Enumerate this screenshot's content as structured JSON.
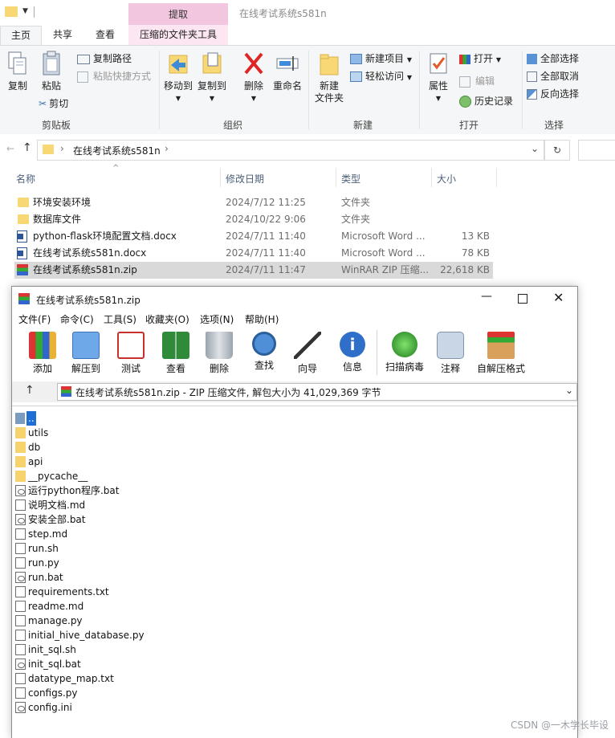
{
  "explorer": {
    "window_title": "在线考试系统s581n",
    "context_tab": "提取",
    "tabs": [
      "主页",
      "共享",
      "查看",
      "压缩的文件夹工具"
    ],
    "ribbon": {
      "copy": "复制",
      "paste": "粘贴",
      "copy_path": "复制路径",
      "paste_shortcut": "粘贴快捷方式",
      "cut": "剪切",
      "group_clipboard": "剪贴板",
      "move_to": "移动到",
      "copy_to": "复制到",
      "delete": "删除",
      "rename": "重命名",
      "group_organize": "组织",
      "new_folder_line1": "新建",
      "new_folder_line2": "文件夹",
      "new_item": "新建项目",
      "easy_access": "轻松访问",
      "group_new": "新建",
      "properties": "属性",
      "open": "打开",
      "edit": "编辑",
      "history": "历史记录",
      "group_open": "打开",
      "select_all": "全部选择",
      "select_none": "全部取消",
      "invert_selection": "反向选择",
      "group_select": "选择"
    },
    "address": {
      "path": "在线考试系统s581n"
    },
    "columns": {
      "name": "名称",
      "date": "修改日期",
      "type": "类型",
      "size": "大小"
    },
    "files": [
      {
        "name": "环境安装环境",
        "date": "2024/7/12 11:25",
        "type": "文件夹",
        "size": "",
        "icon": "folder-icon"
      },
      {
        "name": "数据库文件",
        "date": "2024/10/22 9:06",
        "type": "文件夹",
        "size": "",
        "icon": "folder-icon"
      },
      {
        "name": "python-flask环境配置文档.docx",
        "date": "2024/7/11 11:40",
        "type": "Microsoft Word ...",
        "size": "13 KB",
        "icon": "word-doc-icon"
      },
      {
        "name": "在线考试系统s581n.docx",
        "date": "2024/7/11 11:40",
        "type": "Microsoft Word ...",
        "size": "78 KB",
        "icon": "word-doc-icon"
      },
      {
        "name": "在线考试系统s581n.zip",
        "date": "2024/7/11 11:47",
        "type": "WinRAR ZIP 压缩...",
        "size": "22,618 KB",
        "icon": "winrar-zip-icon"
      }
    ]
  },
  "winrar": {
    "title": "在线考试系统s581n.zip",
    "menu": [
      "文件(F)",
      "命令(C)",
      "工具(S)",
      "收藏夹(O)",
      "选项(N)",
      "帮助(H)"
    ],
    "toolbar": [
      "添加",
      "解压到",
      "测试",
      "查看",
      "删除",
      "查找",
      "向导",
      "信息",
      "扫描病毒",
      "注释",
      "自解压格式"
    ],
    "path_text": "在线考试系统s581n.zip - ZIP 压缩文件, 解包大小为 41,029,369 字节",
    "entries": [
      {
        "name": "..",
        "kind": "up"
      },
      {
        "name": "utils",
        "kind": "folder"
      },
      {
        "name": "db",
        "kind": "folder"
      },
      {
        "name": "api",
        "kind": "folder"
      },
      {
        "name": "__pycache__",
        "kind": "folder"
      },
      {
        "name": "运行python程序.bat",
        "kind": "gear"
      },
      {
        "name": "说明文档.md",
        "kind": "file"
      },
      {
        "name": "安装全部.bat",
        "kind": "gear"
      },
      {
        "name": "step.md",
        "kind": "file"
      },
      {
        "name": "run.sh",
        "kind": "file"
      },
      {
        "name": "run.py",
        "kind": "file"
      },
      {
        "name": "run.bat",
        "kind": "gear"
      },
      {
        "name": "requirements.txt",
        "kind": "file"
      },
      {
        "name": "readme.md",
        "kind": "file"
      },
      {
        "name": "manage.py",
        "kind": "file"
      },
      {
        "name": "initial_hive_database.py",
        "kind": "file"
      },
      {
        "name": "init_sql.sh",
        "kind": "file"
      },
      {
        "name": "init_sql.bat",
        "kind": "gear"
      },
      {
        "name": "datatype_map.txt",
        "kind": "file"
      },
      {
        "name": "configs.py",
        "kind": "file"
      },
      {
        "name": "config.ini",
        "kind": "gear"
      }
    ]
  },
  "watermark": "CSDN @一木学长毕设"
}
